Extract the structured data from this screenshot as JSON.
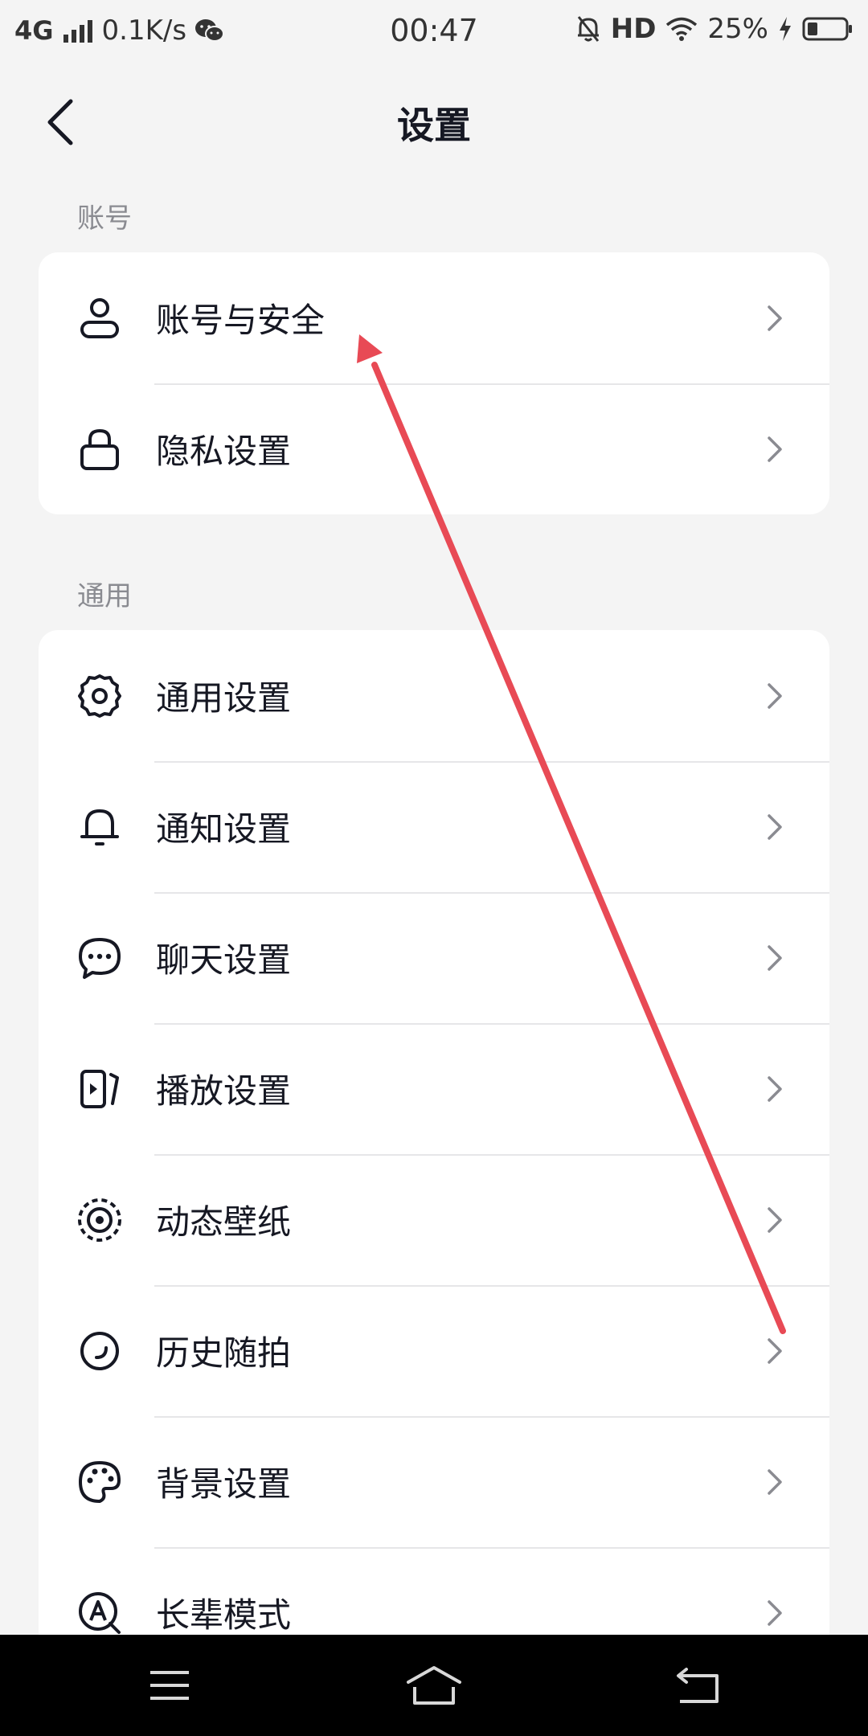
{
  "status_bar": {
    "network": "4G",
    "speed": "0.1K/s",
    "time": "00:47",
    "hd": "HD",
    "battery": "25%"
  },
  "header": {
    "title": "设置"
  },
  "sections": {
    "account": {
      "label": "账号",
      "items": [
        {
          "label": "账号与安全",
          "icon": "user-icon"
        },
        {
          "label": "隐私设置",
          "icon": "lock-icon"
        }
      ]
    },
    "general": {
      "label": "通用",
      "items": [
        {
          "label": "通用设置",
          "icon": "gear-icon"
        },
        {
          "label": "通知设置",
          "icon": "bell-icon"
        },
        {
          "label": "聊天设置",
          "icon": "chat-bubble-icon"
        },
        {
          "label": "播放设置",
          "icon": "play-card-icon"
        },
        {
          "label": "动态壁纸",
          "icon": "live-wallpaper-icon"
        },
        {
          "label": "历史随拍",
          "icon": "history-circle-icon"
        },
        {
          "label": "背景设置",
          "icon": "palette-icon"
        },
        {
          "label": "长辈模式",
          "icon": "elder-mode-icon"
        }
      ]
    }
  },
  "colors": {
    "annotation_arrow": "#e84a55",
    "background": "#f4f4f4",
    "card": "#ffffff"
  }
}
